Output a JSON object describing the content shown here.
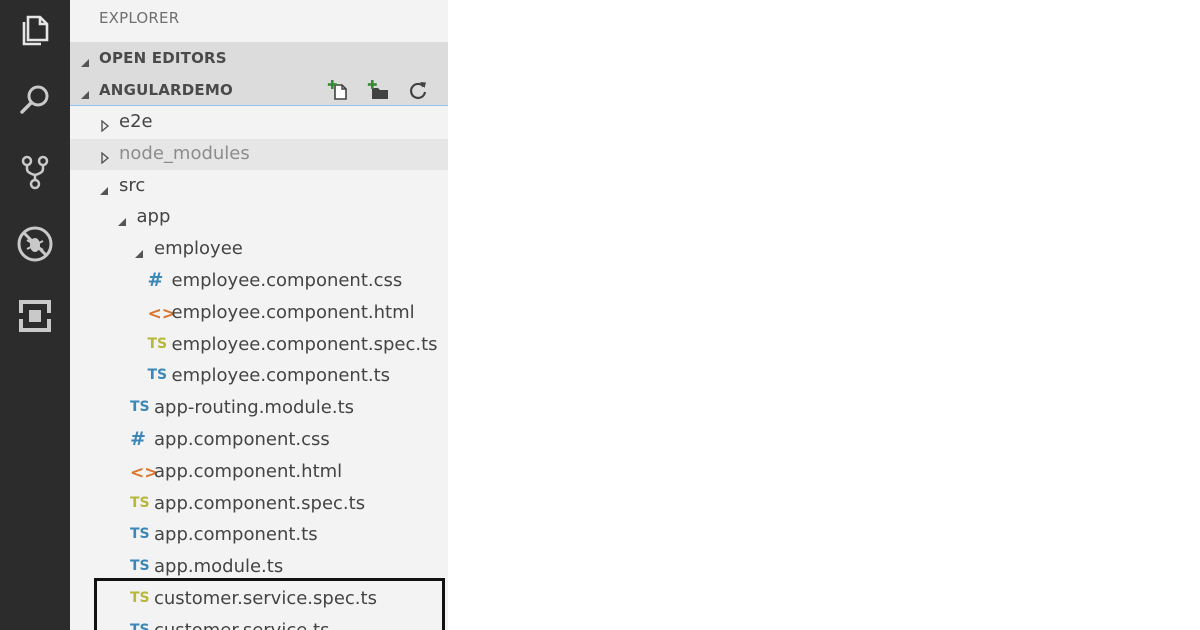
{
  "activity_bar": {
    "items": [
      {
        "icon": "files-icon",
        "name": "explorer"
      },
      {
        "icon": "search-icon",
        "name": "search"
      },
      {
        "icon": "source-control-icon",
        "name": "source-control"
      },
      {
        "icon": "debug-icon",
        "name": "debug"
      },
      {
        "icon": "extensions-icon",
        "name": "extensions"
      }
    ],
    "color": "#2c2c2c",
    "icon_color": "#d8d8d8"
  },
  "explorer": {
    "title": "EXPLORER",
    "open_editors_label": "OPEN EDITORS",
    "project_label": "ANGULARDEMO",
    "actions": [
      {
        "icon": "new-file-icon"
      },
      {
        "icon": "new-folder-icon"
      },
      {
        "icon": "refresh-icon"
      }
    ]
  },
  "tree": [
    {
      "label": "e2e",
      "kind": "folder",
      "expanded": false,
      "depth": 0
    },
    {
      "label": "node_modules",
      "kind": "folder",
      "expanded": false,
      "depth": 0,
      "dim": true
    },
    {
      "label": "src",
      "kind": "folder",
      "expanded": true,
      "depth": 0
    },
    {
      "label": "app",
      "kind": "folder",
      "expanded": true,
      "depth": 1
    },
    {
      "label": "employee",
      "kind": "folder",
      "expanded": true,
      "depth": 2
    },
    {
      "label": "employee.component.css",
      "kind": "css",
      "icon_text": "#",
      "depth": 3
    },
    {
      "label": "employee.component.html",
      "kind": "html",
      "icon_text": "<>",
      "depth": 3
    },
    {
      "label": "employee.component.spec.ts",
      "kind": "ts-spec",
      "icon_text": "TS",
      "depth": 3
    },
    {
      "label": "employee.component.ts",
      "kind": "ts",
      "icon_text": "TS",
      "depth": 3
    },
    {
      "label": "app-routing.module.ts",
      "kind": "ts",
      "icon_text": "TS",
      "depth": 2
    },
    {
      "label": "app.component.css",
      "kind": "css",
      "icon_text": "#",
      "depth": 2
    },
    {
      "label": "app.component.html",
      "kind": "html",
      "icon_text": "<>",
      "depth": 2
    },
    {
      "label": "app.component.spec.ts",
      "kind": "ts-spec",
      "icon_text": "TS",
      "depth": 2
    },
    {
      "label": "app.component.ts",
      "kind": "ts",
      "icon_text": "TS",
      "depth": 2
    },
    {
      "label": "app.module.ts",
      "kind": "ts",
      "icon_text": "TS",
      "depth": 2
    },
    {
      "label": "customer.service.spec.ts",
      "kind": "ts-spec",
      "icon_text": "TS",
      "depth": 2
    },
    {
      "label": "customer.service.ts",
      "kind": "ts",
      "icon_text": "TS",
      "depth": 2
    }
  ],
  "colors": {
    "ts": "#3b87b8",
    "ts_spec": "#b7b73b",
    "css": "#3b87b8",
    "html": "#d9732d",
    "highlight_border": "#111111"
  }
}
